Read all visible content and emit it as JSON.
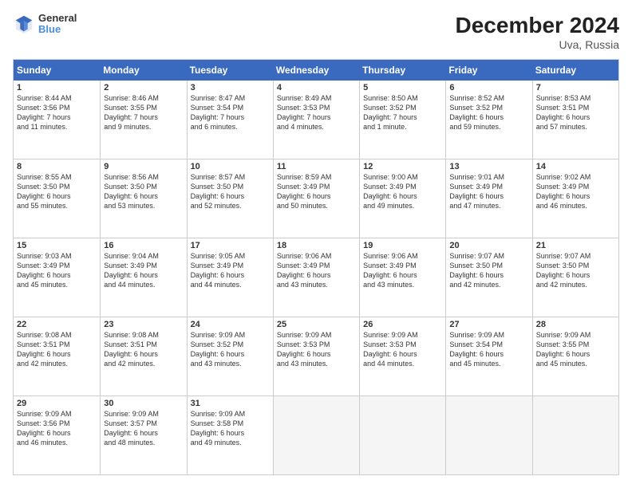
{
  "logo": {
    "line1": "General",
    "line2": "Blue"
  },
  "title": "December 2024",
  "subtitle": "Uva, Russia",
  "days": [
    "Sunday",
    "Monday",
    "Tuesday",
    "Wednesday",
    "Thursday",
    "Friday",
    "Saturday"
  ],
  "rows": [
    [
      {
        "num": "1",
        "info": "Sunrise: 8:44 AM\nSunset: 3:56 PM\nDaylight: 7 hours\nand 11 minutes."
      },
      {
        "num": "2",
        "info": "Sunrise: 8:46 AM\nSunset: 3:55 PM\nDaylight: 7 hours\nand 9 minutes."
      },
      {
        "num": "3",
        "info": "Sunrise: 8:47 AM\nSunset: 3:54 PM\nDaylight: 7 hours\nand 6 minutes."
      },
      {
        "num": "4",
        "info": "Sunrise: 8:49 AM\nSunset: 3:53 PM\nDaylight: 7 hours\nand 4 minutes."
      },
      {
        "num": "5",
        "info": "Sunrise: 8:50 AM\nSunset: 3:52 PM\nDaylight: 7 hours\nand 1 minute."
      },
      {
        "num": "6",
        "info": "Sunrise: 8:52 AM\nSunset: 3:52 PM\nDaylight: 6 hours\nand 59 minutes."
      },
      {
        "num": "7",
        "info": "Sunrise: 8:53 AM\nSunset: 3:51 PM\nDaylight: 6 hours\nand 57 minutes."
      }
    ],
    [
      {
        "num": "8",
        "info": "Sunrise: 8:55 AM\nSunset: 3:50 PM\nDaylight: 6 hours\nand 55 minutes."
      },
      {
        "num": "9",
        "info": "Sunrise: 8:56 AM\nSunset: 3:50 PM\nDaylight: 6 hours\nand 53 minutes."
      },
      {
        "num": "10",
        "info": "Sunrise: 8:57 AM\nSunset: 3:50 PM\nDaylight: 6 hours\nand 52 minutes."
      },
      {
        "num": "11",
        "info": "Sunrise: 8:59 AM\nSunset: 3:49 PM\nDaylight: 6 hours\nand 50 minutes."
      },
      {
        "num": "12",
        "info": "Sunrise: 9:00 AM\nSunset: 3:49 PM\nDaylight: 6 hours\nand 49 minutes."
      },
      {
        "num": "13",
        "info": "Sunrise: 9:01 AM\nSunset: 3:49 PM\nDaylight: 6 hours\nand 47 minutes."
      },
      {
        "num": "14",
        "info": "Sunrise: 9:02 AM\nSunset: 3:49 PM\nDaylight: 6 hours\nand 46 minutes."
      }
    ],
    [
      {
        "num": "15",
        "info": "Sunrise: 9:03 AM\nSunset: 3:49 PM\nDaylight: 6 hours\nand 45 minutes."
      },
      {
        "num": "16",
        "info": "Sunrise: 9:04 AM\nSunset: 3:49 PM\nDaylight: 6 hours\nand 44 minutes."
      },
      {
        "num": "17",
        "info": "Sunrise: 9:05 AM\nSunset: 3:49 PM\nDaylight: 6 hours\nand 44 minutes."
      },
      {
        "num": "18",
        "info": "Sunrise: 9:06 AM\nSunset: 3:49 PM\nDaylight: 6 hours\nand 43 minutes."
      },
      {
        "num": "19",
        "info": "Sunrise: 9:06 AM\nSunset: 3:49 PM\nDaylight: 6 hours\nand 43 minutes."
      },
      {
        "num": "20",
        "info": "Sunrise: 9:07 AM\nSunset: 3:50 PM\nDaylight: 6 hours\nand 42 minutes."
      },
      {
        "num": "21",
        "info": "Sunrise: 9:07 AM\nSunset: 3:50 PM\nDaylight: 6 hours\nand 42 minutes."
      }
    ],
    [
      {
        "num": "22",
        "info": "Sunrise: 9:08 AM\nSunset: 3:51 PM\nDaylight: 6 hours\nand 42 minutes."
      },
      {
        "num": "23",
        "info": "Sunrise: 9:08 AM\nSunset: 3:51 PM\nDaylight: 6 hours\nand 42 minutes."
      },
      {
        "num": "24",
        "info": "Sunrise: 9:09 AM\nSunset: 3:52 PM\nDaylight: 6 hours\nand 43 minutes."
      },
      {
        "num": "25",
        "info": "Sunrise: 9:09 AM\nSunset: 3:53 PM\nDaylight: 6 hours\nand 43 minutes."
      },
      {
        "num": "26",
        "info": "Sunrise: 9:09 AM\nSunset: 3:53 PM\nDaylight: 6 hours\nand 44 minutes."
      },
      {
        "num": "27",
        "info": "Sunrise: 9:09 AM\nSunset: 3:54 PM\nDaylight: 6 hours\nand 45 minutes."
      },
      {
        "num": "28",
        "info": "Sunrise: 9:09 AM\nSunset: 3:55 PM\nDaylight: 6 hours\nand 45 minutes."
      }
    ],
    [
      {
        "num": "29",
        "info": "Sunrise: 9:09 AM\nSunset: 3:56 PM\nDaylight: 6 hours\nand 46 minutes."
      },
      {
        "num": "30",
        "info": "Sunrise: 9:09 AM\nSunset: 3:57 PM\nDaylight: 6 hours\nand 48 minutes."
      },
      {
        "num": "31",
        "info": "Sunrise: 9:09 AM\nSunset: 3:58 PM\nDaylight: 6 hours\nand 49 minutes."
      },
      {
        "num": "",
        "info": ""
      },
      {
        "num": "",
        "info": ""
      },
      {
        "num": "",
        "info": ""
      },
      {
        "num": "",
        "info": ""
      }
    ]
  ]
}
